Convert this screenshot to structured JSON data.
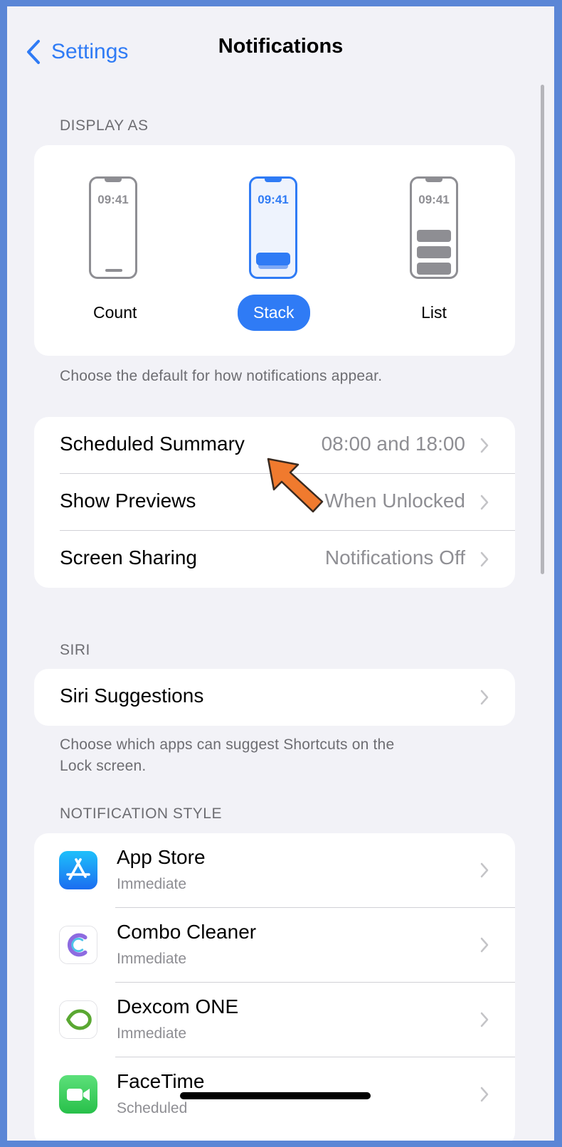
{
  "nav": {
    "back_label": "Settings",
    "title": "Notifications"
  },
  "display_as": {
    "header": "DISPLAY AS",
    "options": [
      {
        "label": "Count",
        "time": "09:41",
        "selected": false
      },
      {
        "label": "Stack",
        "time": "09:41",
        "selected": true
      },
      {
        "label": "List",
        "time": "09:41",
        "selected": false
      }
    ],
    "footer": "Choose the default for how notifications appear."
  },
  "settings_rows": [
    {
      "title": "Scheduled Summary",
      "value": "08:00 and 18:00"
    },
    {
      "title": "Show Previews",
      "value": "When Unlocked"
    },
    {
      "title": "Screen Sharing",
      "value": "Notifications Off"
    }
  ],
  "siri": {
    "header": "SIRI",
    "row_title": "Siri Suggestions",
    "footer_line1": "Choose which apps can suggest Shortcuts on the",
    "footer_line2": "Lock screen."
  },
  "notification_style": {
    "header": "NOTIFICATION STYLE",
    "apps": [
      {
        "name": "App Store",
        "sub": "Immediate",
        "icon": "app-store-icon"
      },
      {
        "name": "Combo Cleaner",
        "sub": "Immediate",
        "icon": "combo-cleaner-icon"
      },
      {
        "name": "Dexcom ONE",
        "sub": "Immediate",
        "icon": "dexcom-icon"
      },
      {
        "name": "FaceTime",
        "sub": "Scheduled",
        "icon": "facetime-icon"
      }
    ]
  },
  "colors": {
    "accent": "#2f7bf5",
    "background": "#f2f2f7",
    "annotation_arrow": "#f07a2e"
  }
}
